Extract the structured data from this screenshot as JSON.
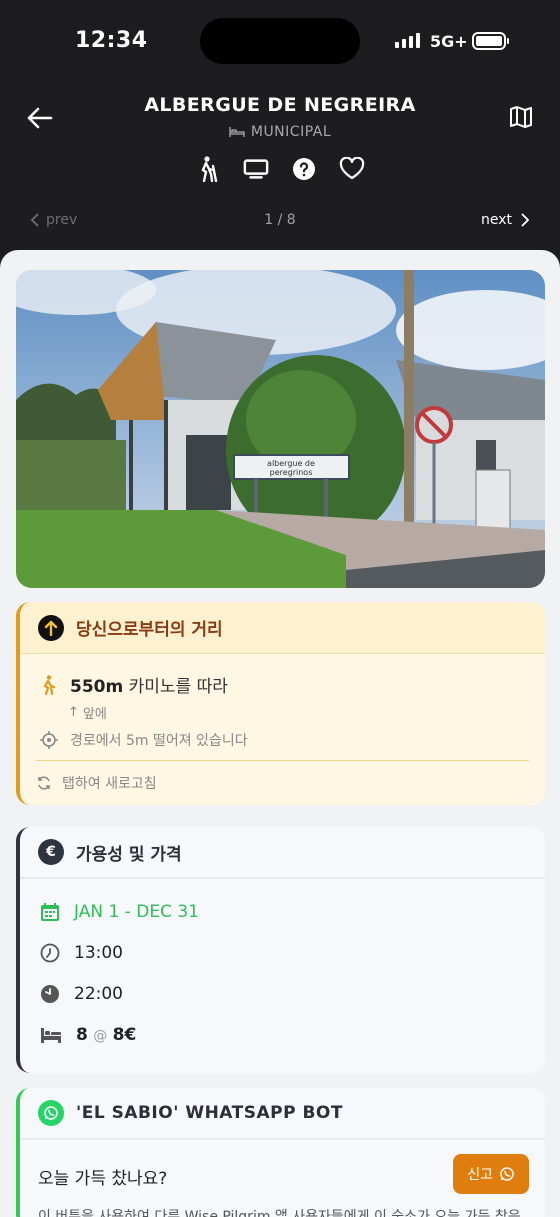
{
  "status_bar": {
    "time": "12:34",
    "network": "5G+"
  },
  "header": {
    "title": "ALBERGUE DE NEGREIRA",
    "type": "MUNICIPAL",
    "icons": [
      "hiker-icon",
      "screen-icon",
      "help-icon",
      "heart-icon"
    ],
    "prev_label": "prev",
    "page": "1 / 8",
    "next_label": "next"
  },
  "photo": {
    "sign_text_1": "albergue de",
    "sign_text_2": "peregrinos"
  },
  "distance": {
    "title": "당신으로부터의 거리",
    "amount": "550m",
    "along": "카미노를 따라",
    "direction": "앞에",
    "off_route": "경로에서 5m 떨어져 있습니다",
    "refresh": "탭하여 새로고침"
  },
  "availability": {
    "title": "가용성 및 가격",
    "badge": "€",
    "season": "JAN 1 - DEC 31",
    "opening": "13:00",
    "closing": "22:00",
    "beds": "8",
    "at": "@",
    "price": "8€"
  },
  "bot": {
    "title": "'EL SABIO' WHATSAPP BOT",
    "question": "오늘 가득 찼나요?",
    "report_label": "신고",
    "description": "이 버튼을 사용하여 다른 Wise Pilgrim 앱 사용자들에게 이 숙소가 오늘 가득 찼음"
  },
  "colors": {
    "accent_orange": "#e29a20",
    "green": "#2ebd59",
    "whatsapp": "#25d366",
    "dark": "#1d1d1f"
  }
}
